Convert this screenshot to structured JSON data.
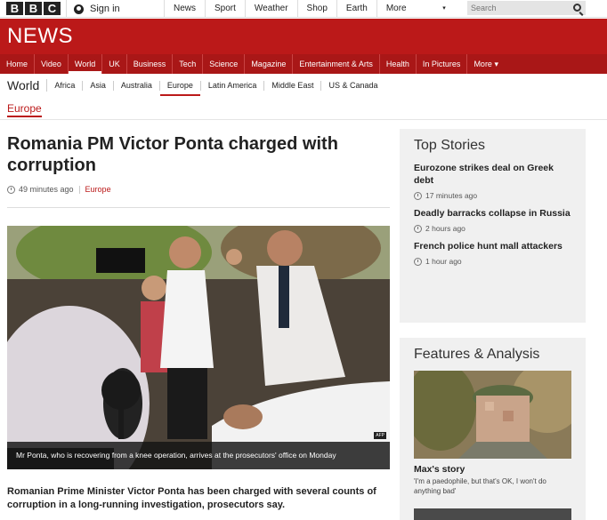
{
  "brand": {
    "letters": [
      "B",
      "B",
      "C"
    ]
  },
  "header": {
    "sign_in": "Sign in",
    "nav": [
      "News",
      "Sport",
      "Weather",
      "Shop",
      "Earth",
      "More"
    ],
    "search_placeholder": "Search"
  },
  "banner": {
    "title": "NEWS"
  },
  "main_nav": [
    {
      "label": "Home"
    },
    {
      "label": "Video"
    },
    {
      "label": "World",
      "active": true
    },
    {
      "label": "UK"
    },
    {
      "label": "Business"
    },
    {
      "label": "Tech"
    },
    {
      "label": "Science"
    },
    {
      "label": "Magazine"
    },
    {
      "label": "Entertainment & Arts"
    },
    {
      "label": "Health"
    },
    {
      "label": "In Pictures"
    },
    {
      "label": "More ▾"
    }
  ],
  "sub_nav": {
    "section": "World",
    "items": [
      "Africa",
      "Asia",
      "Australia",
      "Europe",
      "Latin America",
      "Middle East",
      "US & Canada"
    ],
    "active": "Europe"
  },
  "breadcrumb": "Europe",
  "article": {
    "headline": "Romania PM Victor Ponta charged with corruption",
    "time": "49 minutes ago",
    "section": "Europe",
    "caption": "Mr Ponta, who is recovering from a knee operation, arrives at the prosecutors' office on Monday",
    "photo_credit": "AFP",
    "intro": "Romanian Prime Minister Victor Ponta has been charged with several counts of corruption in a long-running investigation, prosecutors say."
  },
  "top_stories": {
    "title": "Top Stories",
    "items": [
      {
        "title": "Eurozone strikes deal on Greek debt",
        "time": "17 minutes ago"
      },
      {
        "title": "Deadly barracks collapse in Russia",
        "time": "2 hours ago"
      },
      {
        "title": "French police hunt mall attackers",
        "time": "1 hour ago"
      }
    ]
  },
  "features": {
    "title": "Features & Analysis",
    "items": [
      {
        "title": "Max's story",
        "desc": "'I'm a paedophile, but that's OK, I won't do anything bad'"
      }
    ]
  },
  "colors": {
    "bbc_red": "#bb1919",
    "nav_red": "#a91717",
    "panel_grey": "#f0f0f0"
  }
}
